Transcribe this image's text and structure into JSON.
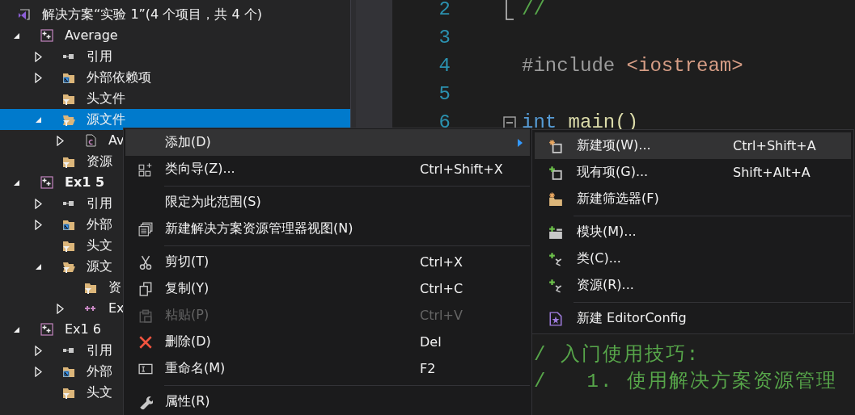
{
  "solution_explorer": {
    "tree": [
      {
        "label": "解决方案“实验 1”(4 个项目，共 4 个)",
        "kind": "solution",
        "selected": false,
        "children": [
          {
            "label": "Average",
            "kind": "project",
            "expanded": true,
            "selected": false,
            "startup": false,
            "children": [
              {
                "label": "引用",
                "kind": "references",
                "expanded": false,
                "selected": false
              },
              {
                "label": "外部依赖项",
                "kind": "external",
                "expanded": false,
                "selected": false
              },
              {
                "label": "头文件",
                "kind": "filter",
                "selected": false
              },
              {
                "label": "源文件",
                "kind": "filter-open",
                "expanded": true,
                "selected": true,
                "children": [
                  {
                    "label": "Av",
                    "kind": "cpp-file",
                    "expanded": false,
                    "selected": false
                  }
                ]
              },
              {
                "label": "资源",
                "kind": "filter",
                "selected": false
              }
            ]
          },
          {
            "label": "Ex1 5",
            "kind": "project",
            "expanded": true,
            "selected": false,
            "startup": true,
            "children": [
              {
                "label": "引用",
                "kind": "references",
                "expanded": false,
                "selected": false
              },
              {
                "label": "外部",
                "kind": "external",
                "expanded": false,
                "selected": false
              },
              {
                "label": "头文",
                "kind": "filter",
                "selected": false
              },
              {
                "label": "源文",
                "kind": "filter-open",
                "expanded": true,
                "selected": false,
                "children": [
                  {
                    "label": "资",
                    "kind": "filter",
                    "selected": false
                  },
                  {
                    "label": "Ex",
                    "kind": "cpp-plus",
                    "expanded": false,
                    "selected": false
                  }
                ]
              }
            ]
          },
          {
            "label": "Ex1 6",
            "kind": "project",
            "expanded": true,
            "selected": false,
            "startup": false,
            "children": [
              {
                "label": "引用",
                "kind": "references",
                "expanded": false,
                "selected": false
              },
              {
                "label": "外部",
                "kind": "external",
                "expanded": false,
                "selected": false
              },
              {
                "label": "头文",
                "kind": "filter",
                "selected": false
              }
            ]
          }
        ]
      }
    ]
  },
  "editor": {
    "lines": [
      {
        "number": "2",
        "kind": "fold-end",
        "code": [
          {
            "text": "//",
            "kind": "comment"
          }
        ]
      },
      {
        "number": "3",
        "kind": "plain"
      },
      {
        "number": "4",
        "kind": "plain",
        "code": [
          {
            "text": "#include",
            "kind": "preproc"
          },
          {
            "text": " <iostream>",
            "kind": "string"
          }
        ]
      },
      {
        "number": "5",
        "kind": "plain"
      },
      {
        "number": "6",
        "kind": "fold-start",
        "code": [
          {
            "text": "int",
            "kind": "keyword"
          },
          {
            "text": " main()",
            "kind": "function"
          }
        ]
      }
    ],
    "lower_lines": [
      {
        "code": [
          {
            "text": "/ 入门使用技巧:",
            "kind": "comment"
          }
        ]
      },
      {
        "code": [
          {
            "text": "/   1. 使用解决方案资源管理",
            "kind": "comment"
          }
        ]
      }
    ]
  },
  "context_menu": {
    "items": [
      {
        "kind": "plain",
        "label": "添加(D)",
        "selected": true,
        "disabled": false,
        "submenu": true
      },
      {
        "kind": "class-wizard",
        "label": "类向导(Z)...",
        "shortcut": "Ctrl+Shift+X",
        "selected": false,
        "disabled": false,
        "submenu": false
      },
      {
        "kind": "separator"
      },
      {
        "kind": "plain",
        "label": "限定为此范围(S)",
        "selected": false,
        "disabled": false,
        "submenu": false
      },
      {
        "kind": "windows",
        "label": "新建解决方案资源管理器视图(N)",
        "selected": false,
        "disabled": false,
        "submenu": false
      },
      {
        "kind": "separator"
      },
      {
        "kind": "cut",
        "label": "剪切(T)",
        "shortcut": "Ctrl+X",
        "selected": false,
        "disabled": false,
        "submenu": false
      },
      {
        "kind": "copy",
        "label": "复制(Y)",
        "shortcut": "Ctrl+C",
        "selected": false,
        "disabled": false,
        "submenu": false
      },
      {
        "kind": "paste",
        "label": "粘贴(P)",
        "shortcut": "Ctrl+V",
        "selected": false,
        "disabled": true,
        "submenu": false
      },
      {
        "kind": "delete",
        "label": "删除(D)",
        "shortcut": "Del",
        "selected": false,
        "disabled": false,
        "submenu": false
      },
      {
        "kind": "rename",
        "label": "重命名(M)",
        "shortcut": "F2",
        "selected": false,
        "disabled": false,
        "submenu": false
      },
      {
        "kind": "separator"
      },
      {
        "kind": "properties",
        "label": "属性(R)",
        "selected": false,
        "disabled": false,
        "submenu": false
      }
    ]
  },
  "submenu": {
    "items": [
      {
        "kind": "new-item",
        "label": "新建项(W)...",
        "shortcut": "Ctrl+Shift+A",
        "selected": true,
        "disabled": false,
        "submenu": false
      },
      {
        "kind": "existing-item",
        "label": "现有项(G)...",
        "shortcut": "Shift+Alt+A",
        "selected": false,
        "disabled": false,
        "submenu": false
      },
      {
        "kind": "new-filter",
        "label": "新建筛选器(F)",
        "selected": false,
        "disabled": false,
        "submenu": false
      },
      {
        "kind": "separator"
      },
      {
        "kind": "module",
        "label": "模块(M)...",
        "selected": false,
        "disabled": false,
        "submenu": false
      },
      {
        "kind": "class",
        "label": "类(C)...",
        "selected": false,
        "disabled": false,
        "submenu": false
      },
      {
        "kind": "resource",
        "label": "资源(R)...",
        "selected": false,
        "disabled": false,
        "submenu": false
      },
      {
        "kind": "separator"
      },
      {
        "kind": "editorconfig",
        "label": "新建 EditorConfig",
        "selected": false,
        "disabled": false,
        "submenu": false
      }
    ]
  }
}
